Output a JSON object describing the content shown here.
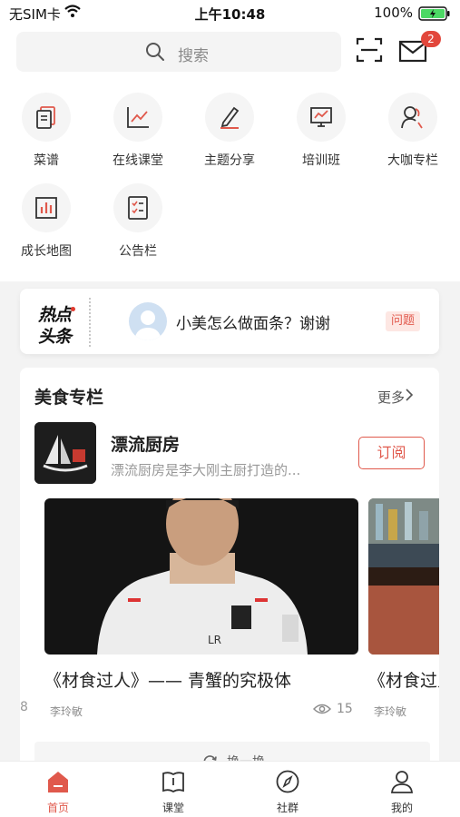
{
  "status_bar": {
    "carrier": "无SIM卡",
    "time": "上午10:48",
    "battery": "100%"
  },
  "header": {
    "search_placeholder": "搜索",
    "mail_badge": "2"
  },
  "grid": {
    "items": [
      {
        "label": "菜谱",
        "icon": "recipe-icon"
      },
      {
        "label": "在线课堂",
        "icon": "chart-line-icon"
      },
      {
        "label": "主题分享",
        "icon": "pen-icon"
      },
      {
        "label": "培训班",
        "icon": "presentation-icon"
      },
      {
        "label": "大咖专栏",
        "icon": "people-icon"
      },
      {
        "label": "成长地图",
        "icon": "bar-chart-icon"
      },
      {
        "label": "公告栏",
        "icon": "checklist-icon"
      }
    ]
  },
  "hot": {
    "logo_line1": "热点",
    "logo_line2": "头条",
    "text": "小美怎么做面条？谢谢",
    "tag": "问题"
  },
  "food": {
    "title": "美食专栏",
    "more": "更多",
    "column_name": "漂流厨房",
    "column_desc": "漂流厨房是李大刚主厨打造的...",
    "subscribe": "订阅",
    "articles": [
      {
        "title": "《材食过人》—— 青蟹的究极体",
        "author": "李玲敏",
        "views": "15"
      },
      {
        "title": "《材食过人》",
        "author": "李玲敏"
      }
    ],
    "edge_number": "8",
    "refresh": "换一换"
  },
  "tabbar": {
    "tabs": [
      {
        "label": "首页"
      },
      {
        "label": "课堂"
      },
      {
        "label": "社群"
      },
      {
        "label": "我的"
      }
    ]
  },
  "colors": {
    "accent": "#e0594c",
    "badge": "#e2473c"
  }
}
